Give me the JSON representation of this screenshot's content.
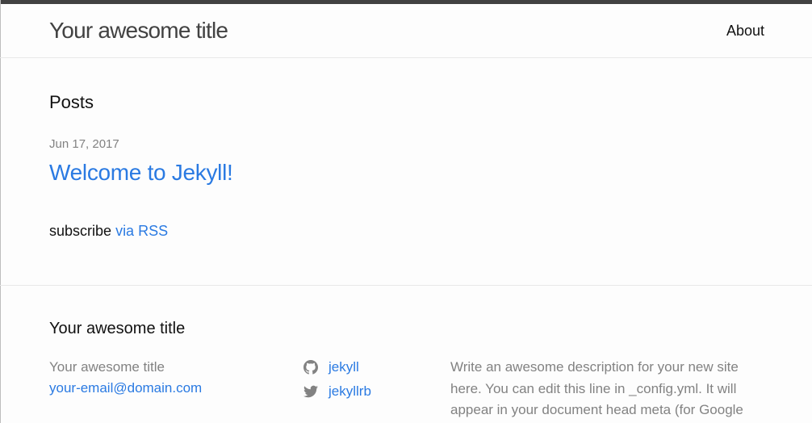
{
  "header": {
    "site_title": "Your awesome title",
    "nav": [
      {
        "label": "About"
      }
    ]
  },
  "main": {
    "posts_heading": "Posts",
    "posts": [
      {
        "date": "Jun 17, 2017",
        "title": "Welcome to Jekyll!"
      }
    ],
    "subscribe_prefix": "subscribe",
    "rss_label": "via RSS"
  },
  "footer": {
    "heading": "Your awesome title",
    "name": "Your awesome title",
    "email": "your-email@domain.com",
    "social": [
      {
        "icon": "github-icon",
        "label": "jekyll"
      },
      {
        "icon": "twitter-icon",
        "label": "jekyllrb"
      }
    ],
    "description": "Write an awesome description for your new site here. You can edit this line in _config.yml. It will appear in your document head meta (for Google"
  },
  "colors": {
    "link": "#2a7ae2",
    "meta_text": "#828282",
    "top_border": "#424242",
    "divider": "#e8e8e8",
    "background": "#fdfdfd",
    "icon": "#828282"
  }
}
